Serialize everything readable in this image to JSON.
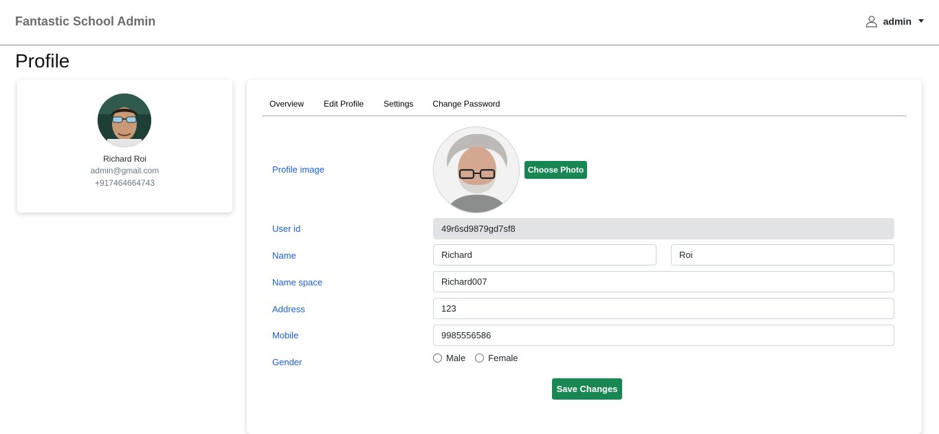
{
  "navbar": {
    "brand": "Fantastic School Admin",
    "user": "admin",
    "user_icon": "user-icon"
  },
  "page": {
    "title": "Profile"
  },
  "profile_card": {
    "name": "Richard Roi",
    "email": "admin@gmail.com",
    "phone": "+917464664743"
  },
  "tabs": [
    {
      "label": "Overview"
    },
    {
      "label": "Edit Profile"
    },
    {
      "label": "Settings"
    },
    {
      "label": "Change Password"
    }
  ],
  "form": {
    "profile_image_label": "Profile image",
    "choose_photo": "Choose Photo",
    "user_id_label": "User id",
    "user_id": "49r6sd9879gd7sf8",
    "name_label": "Name",
    "first_name": "Richard",
    "last_name": "Roi",
    "namespace_label": "Name space",
    "namespace": "Richard007",
    "address_label": "Address",
    "address": "123",
    "mobile_label": "Mobile",
    "mobile": "9985556586",
    "gender_label": "Gender",
    "gender_options": [
      "Male",
      "Female"
    ],
    "save": "Save Changes"
  },
  "colors": {
    "accent_green": "#198754",
    "label_blue": "#1a5fd6"
  }
}
